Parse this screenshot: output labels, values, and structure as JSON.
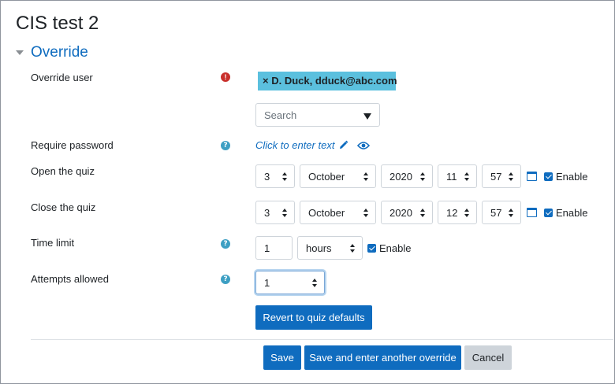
{
  "page": {
    "title": "CIS test 2"
  },
  "section": {
    "title": "Override"
  },
  "override_user": {
    "label": "Override user",
    "selected_chip": "× D. Duck, dduck@abc.com",
    "search_placeholder": "Search"
  },
  "require_password": {
    "label": "Require password",
    "inplace_text": "Click to enter text"
  },
  "open_quiz": {
    "label": "Open the quiz",
    "day": "3",
    "month": "October",
    "year": "2020",
    "hour": "11",
    "minute": "57",
    "enable_label": "Enable"
  },
  "close_quiz": {
    "label": "Close the quiz",
    "day": "3",
    "month": "October",
    "year": "2020",
    "hour": "12",
    "minute": "57",
    "enable_label": "Enable"
  },
  "time_limit": {
    "label": "Time limit",
    "value": "1",
    "unit": "hours",
    "enable_label": "Enable"
  },
  "attempts": {
    "label": "Attempts allowed",
    "value": "1"
  },
  "buttons": {
    "revert": "Revert to quiz defaults",
    "save": "Save",
    "save_another": "Save and enter another override",
    "cancel": "Cancel"
  },
  "colors": {
    "primary": "#0f6cbf",
    "chip": "#5bc0de",
    "help_icon": "#3d9fc3",
    "error_icon": "#c9302c"
  },
  "icons": {
    "help": "question-circle-icon",
    "error": "exclamation-circle-icon",
    "edit": "pencil-icon",
    "reveal": "eye-icon",
    "calendar": "calendar-icon",
    "section_toggle": "caret-down-icon"
  }
}
